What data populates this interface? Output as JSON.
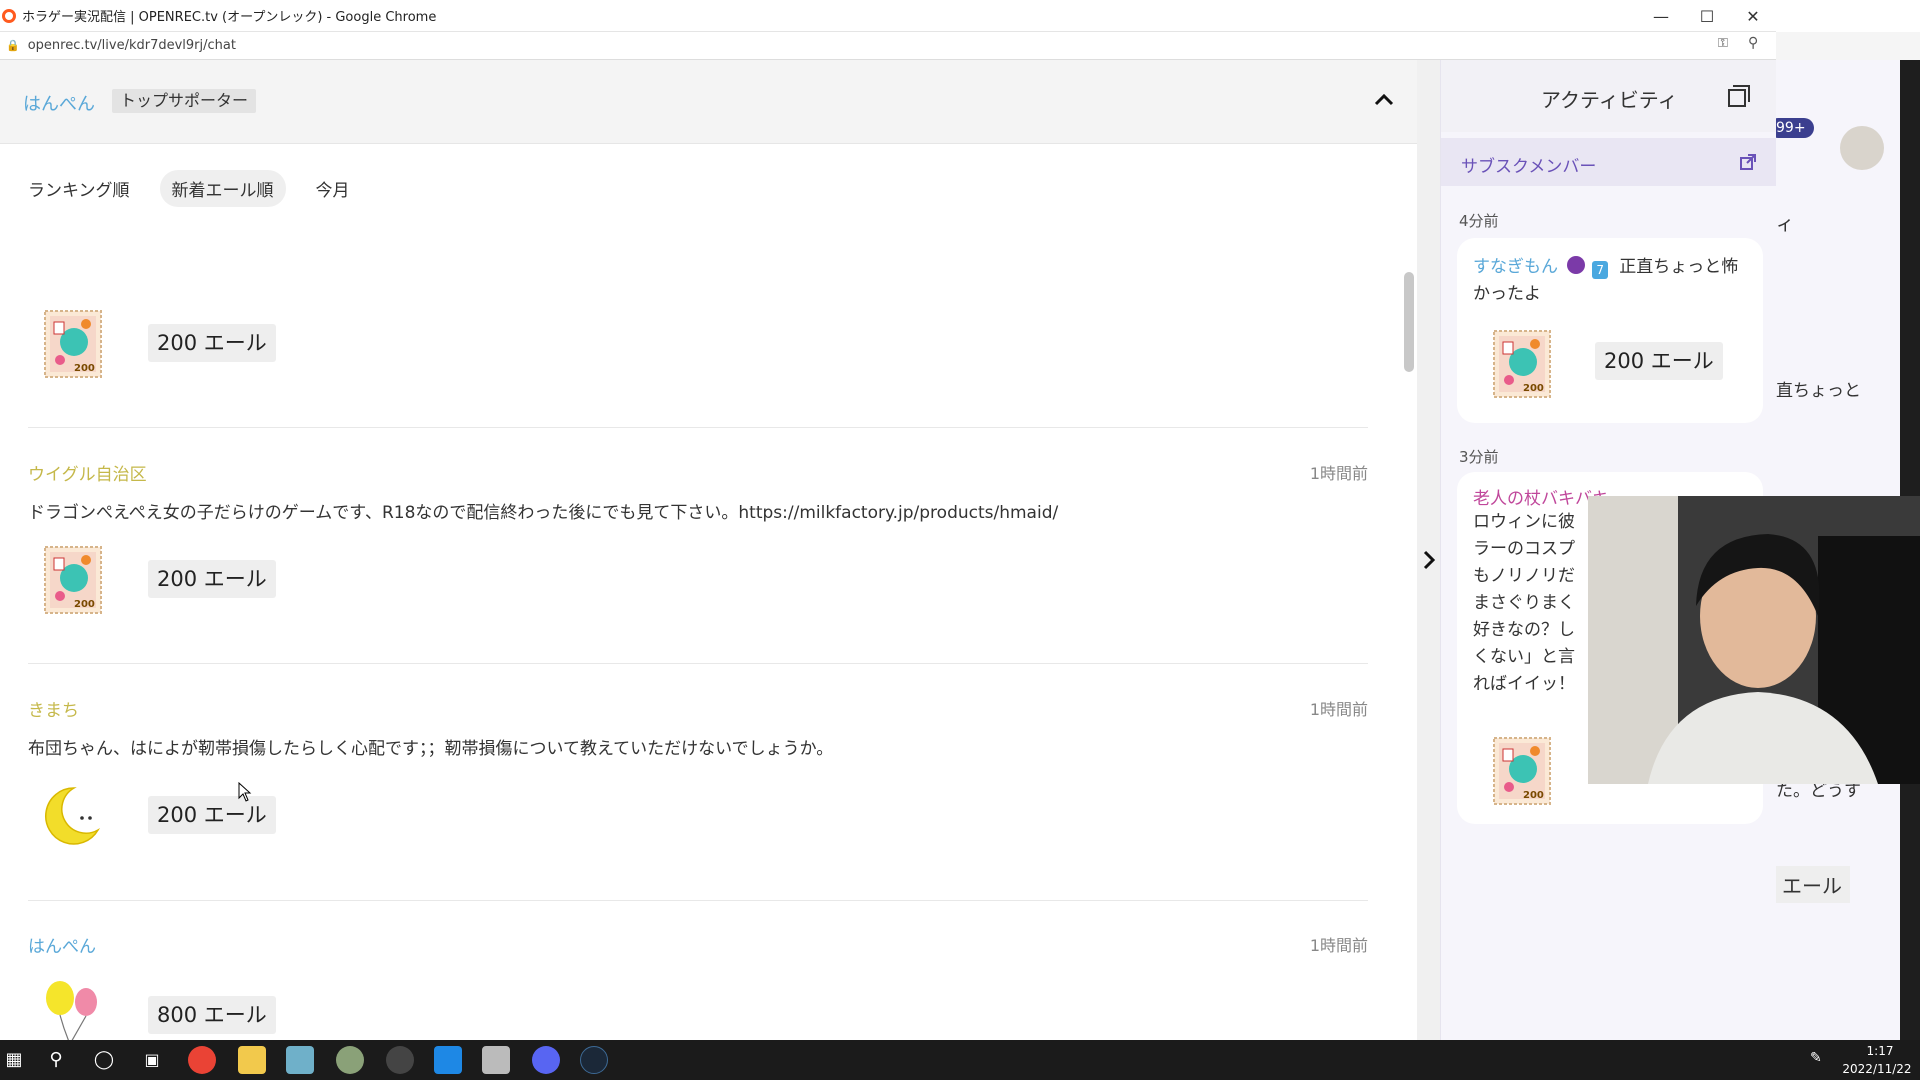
{
  "browser": {
    "window_title": "ホラゲー実況配信 | OPENREC.tv (オープンレック) - Google Chrome",
    "url": "openrec.tv/live/kdr7devl9rj/chat"
  },
  "supporter_bar": {
    "user_name": "はんぺん",
    "badge": "トップサポーター"
  },
  "sort_tabs": [
    "ランキング順",
    "新着エール順",
    "今月"
  ],
  "entries": [
    {
      "user": "",
      "time": "",
      "message": "",
      "yell": "200 エール",
      "gift": "stamp-200-icon"
    },
    {
      "user": "ウイグル自治区",
      "user_color": "#c5b84a",
      "time": "1時間前",
      "message": "ドラゴンぺえぺえ女の子だらけのゲームです、R18なので配信終わった後にでも見て下さい。https://milkfactory.jp/products/hmaid/",
      "yell": "200 エール",
      "gift": "stamp-200-icon"
    },
    {
      "user": "きまち",
      "user_color": "#c5b84a",
      "time": "1時間前",
      "message": "布団ちゃん、はによが靭帯損傷したらしく心配です；；靭帯損傷について教えていただけないでしょうか。",
      "yell": "200 エール",
      "gift": "crescent-moon-icon"
    },
    {
      "user": "はんぺん",
      "user_color": "#5aa8d8",
      "time": "1時間前",
      "message": "",
      "yell": "800 エール",
      "gift": "balloons-icon"
    }
  ],
  "activity": {
    "title": "アクティビティ",
    "subs_label": "サブスクメンバー",
    "items": [
      {
        "time": "4分前",
        "user": "すなぎもん",
        "badge_num": "7",
        "text": "正直ちょっと怖かったよ",
        "yell": "200 エール"
      },
      {
        "time": "3分前",
        "user": "老人の杖バキバキ",
        "lines": [
          "ロウィンに彼",
          "ラーのコスプ",
          "もノリノリだ",
          "まさぐりまく",
          "好きなの？し",
          "くない」と言",
          "ればイイッ！"
        ]
      }
    ]
  },
  "background_window": {
    "badge": "99+",
    "fragments": [
      "ィ",
      "直ちょっと",
      "エール",
      "た。どうす",
      "エール"
    ]
  },
  "taskbar": {
    "time": "1:17",
    "date": "2022/11/22"
  },
  "colors": {
    "accent_blue": "#5aa8d8",
    "name_yellow": "#c5b84a",
    "subs_purple": "#6a52b8",
    "pink_name": "#c0479b"
  }
}
